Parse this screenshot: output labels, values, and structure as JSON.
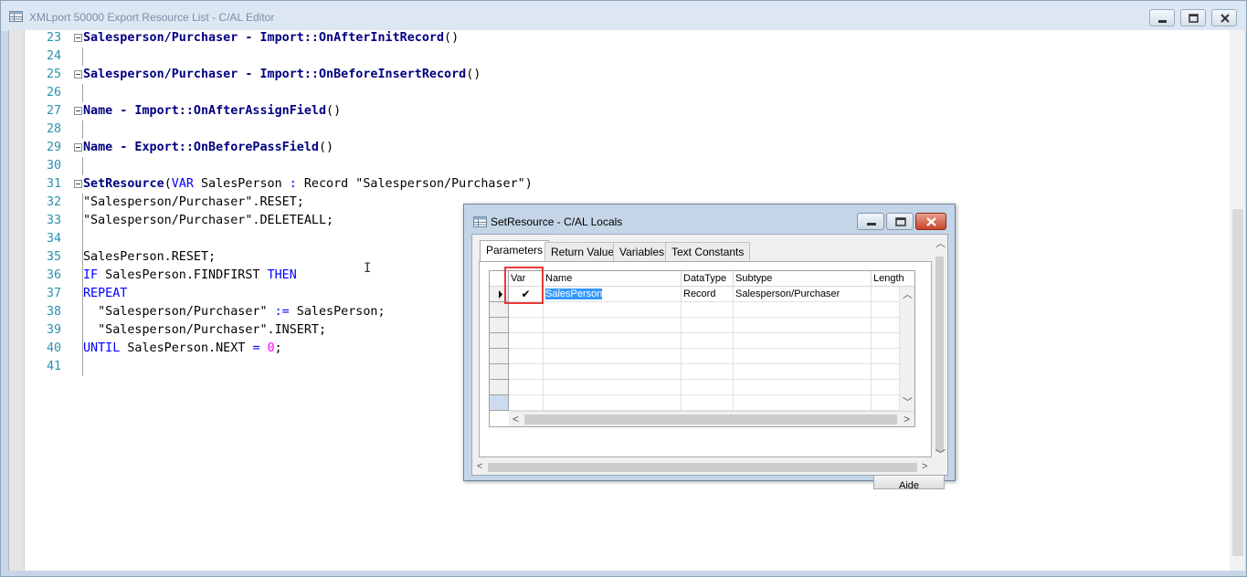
{
  "window": {
    "title": "XMLport 50000 Export Resource List - C/AL Editor"
  },
  "code_lines": [
    {
      "num": "23",
      "fold": true,
      "parts": [
        {
          "t": "Salesperson/Purchaser - Import::OnAfterInitRecord",
          "c": "t-fn"
        },
        {
          "t": "()",
          "c": "t-plain"
        }
      ]
    },
    {
      "num": "24",
      "fold": false,
      "parts": []
    },
    {
      "num": "25",
      "fold": true,
      "parts": [
        {
          "t": "Salesperson/Purchaser - Import::OnBeforeInsertRecord",
          "c": "t-fn"
        },
        {
          "t": "()",
          "c": "t-plain"
        }
      ]
    },
    {
      "num": "26",
      "fold": false,
      "parts": []
    },
    {
      "num": "27",
      "fold": true,
      "parts": [
        {
          "t": "Name - Import::OnAfterAssignField",
          "c": "t-fn"
        },
        {
          "t": "()",
          "c": "t-plain"
        }
      ]
    },
    {
      "num": "28",
      "fold": false,
      "parts": []
    },
    {
      "num": "29",
      "fold": true,
      "parts": [
        {
          "t": "Name - Export::OnBeforePassField",
          "c": "t-fn"
        },
        {
          "t": "()",
          "c": "t-plain"
        }
      ]
    },
    {
      "num": "30",
      "fold": false,
      "parts": []
    },
    {
      "num": "31",
      "fold": true,
      "parts": [
        {
          "t": "SetResource",
          "c": "t-fn"
        },
        {
          "t": "(",
          "c": "t-plain"
        },
        {
          "t": "VAR",
          "c": "t-kw"
        },
        {
          "t": " SalesPerson ",
          "c": "t-plain"
        },
        {
          "t": ":",
          "c": "t-kw"
        },
        {
          "t": " Record \"Salesperson/Purchaser\")",
          "c": "t-plain"
        }
      ]
    },
    {
      "num": "32",
      "fold": false,
      "parts": [
        {
          "t": "\"Salesperson/Purchaser\".RESET;",
          "c": "t-plain"
        }
      ]
    },
    {
      "num": "33",
      "fold": false,
      "parts": [
        {
          "t": "\"Salesperson/Purchaser\".DELETEALL;",
          "c": "t-plain"
        }
      ]
    },
    {
      "num": "34",
      "fold": false,
      "parts": []
    },
    {
      "num": "35",
      "fold": false,
      "parts": [
        {
          "t": "SalesPerson.RESET;",
          "c": "t-plain"
        }
      ]
    },
    {
      "num": "36",
      "fold": false,
      "parts": [
        {
          "t": "IF",
          "c": "t-kw"
        },
        {
          "t": " SalesPerson.FINDFIRST ",
          "c": "t-plain"
        },
        {
          "t": "THEN",
          "c": "t-kw"
        }
      ]
    },
    {
      "num": "37",
      "fold": false,
      "parts": [
        {
          "t": "REPEAT",
          "c": "t-kw"
        }
      ]
    },
    {
      "num": "38",
      "fold": false,
      "parts": [
        {
          "t": "  \"Salesperson/Purchaser\" ",
          "c": "t-plain"
        },
        {
          "t": ":=",
          "c": "t-kw"
        },
        {
          "t": " SalesPerson;",
          "c": "t-plain"
        }
      ]
    },
    {
      "num": "39",
      "fold": false,
      "parts": [
        {
          "t": "  \"Salesperson/Purchaser\".INSERT;",
          "c": "t-plain"
        }
      ]
    },
    {
      "num": "40",
      "fold": false,
      "parts": [
        {
          "t": "UNTIL",
          "c": "t-kw"
        },
        {
          "t": " SalesPerson.NEXT ",
          "c": "t-plain"
        },
        {
          "t": "=",
          "c": "t-kw"
        },
        {
          "t": " ",
          "c": "t-plain"
        },
        {
          "t": "0",
          "c": "t-num"
        },
        {
          "t": ";",
          "c": "t-plain"
        }
      ]
    },
    {
      "num": "41",
      "fold": false,
      "parts": []
    }
  ],
  "dialog": {
    "title": "SetResource - C/AL Locals",
    "tabs": [
      "Parameters",
      "Return Value",
      "Variables",
      "Text Constants"
    ],
    "active_tab": "Parameters",
    "columns": [
      "Var",
      "Name",
      "DataType",
      "Subtype",
      "Length"
    ],
    "rows": [
      {
        "var": "✔",
        "name": "SalesPerson",
        "datatype": "Record",
        "subtype": "Salesperson/Purchaser",
        "length": ""
      }
    ],
    "empty_rows": 7,
    "help_button": "Aide"
  },
  "icons": {
    "minimize": "minimize-icon",
    "maximize": "maximize-icon",
    "close": "close-icon",
    "row_pointer": "row-pointer-icon"
  },
  "colors": {
    "keyword": "#0000ff",
    "function": "#000080",
    "number": "#ff00ff",
    "line_number": "#2b91af",
    "highlight": "#e83a3a",
    "selection": "#3399ff"
  }
}
